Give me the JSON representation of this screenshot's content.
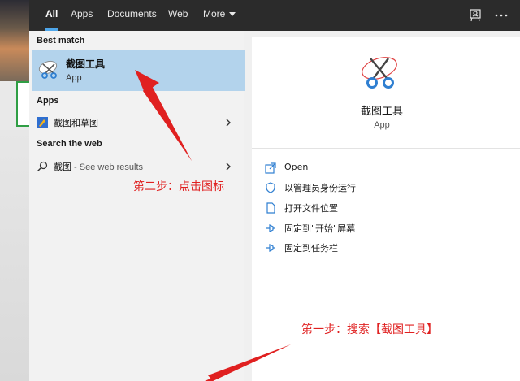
{
  "tabs": {
    "all": "All",
    "apps": "Apps",
    "documents": "Documents",
    "web": "Web",
    "more": "More"
  },
  "topbar_icons": [
    "feedback-icon",
    "more-options-icon"
  ],
  "results": {
    "best_match_heading": "Best match",
    "best_match": {
      "name": "截图工具",
      "type": "App",
      "icon": "snipping-tool-icon"
    },
    "apps_heading": "Apps",
    "apps": [
      {
        "name": "截图和草图",
        "icon": "snip-sketch-icon"
      }
    ],
    "web_heading": "Search the web",
    "web": [
      {
        "query": "截图",
        "suffix": " - See web results",
        "icon": "search-icon"
      }
    ]
  },
  "detail": {
    "name": "截图工具",
    "type": "App",
    "actions": [
      {
        "label": "Open",
        "icon": "open-icon"
      },
      {
        "label": "以管理员身份运行",
        "icon": "run-as-admin-icon"
      },
      {
        "label": "打开文件位置",
        "icon": "file-location-icon"
      },
      {
        "label": "固定到\"开始\"屏幕",
        "icon": "pin-start-icon"
      },
      {
        "label": "固定到任务栏",
        "icon": "pin-taskbar-icon"
      }
    ]
  },
  "annotations": {
    "step2": "第二步：点击图标",
    "step1": "第一步：搜索【截图工具】"
  },
  "colors": {
    "topbar": "#2b2b2b",
    "selected": "#b3d3ec",
    "accent": "#4ea6ea",
    "annotation": "#e02020"
  }
}
